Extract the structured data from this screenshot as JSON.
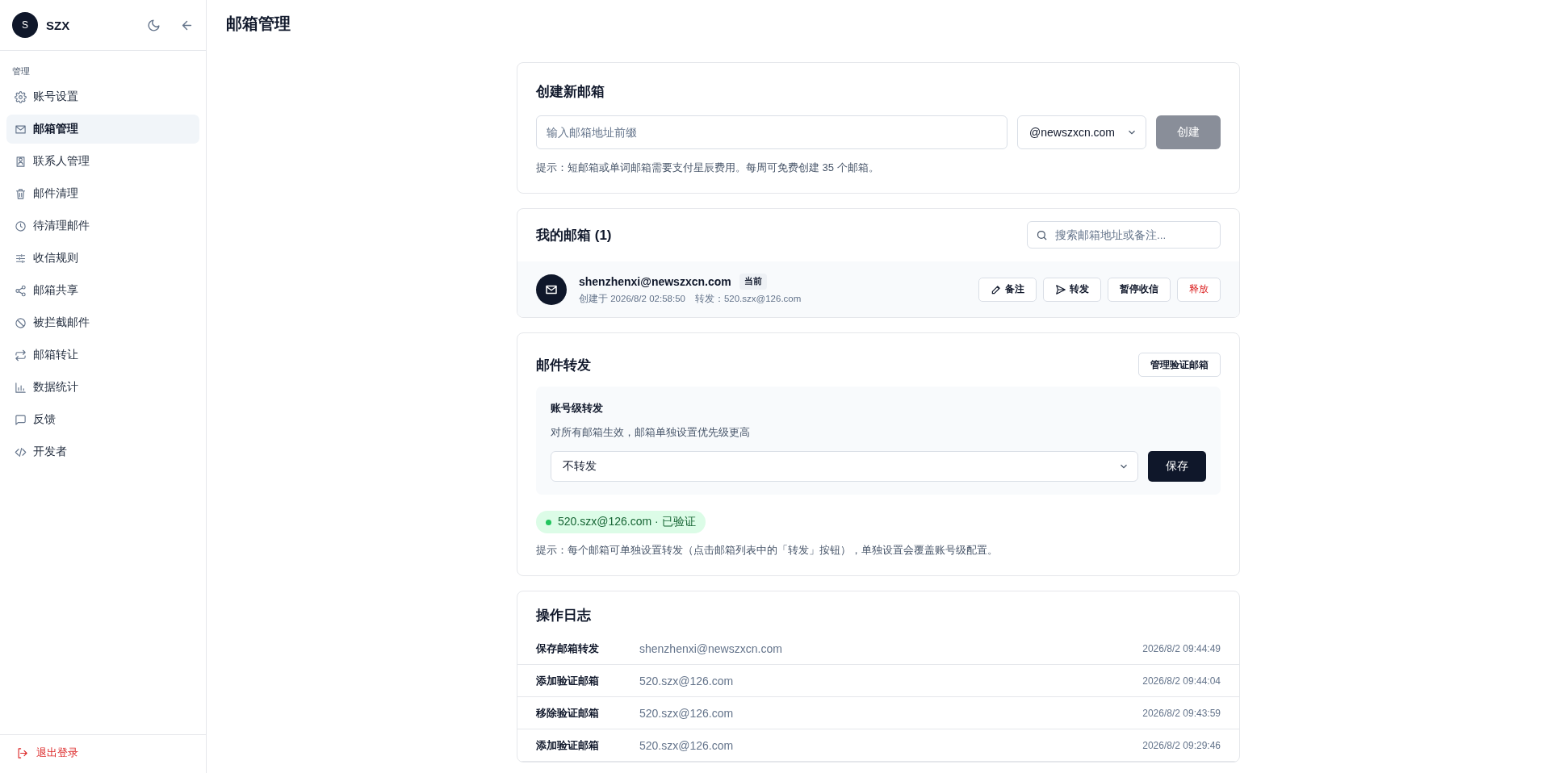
{
  "sidebar": {
    "user": {
      "initial": "S",
      "name": "SZX"
    },
    "section_label": "管理",
    "items": [
      {
        "label": "账号设置",
        "selected": false
      },
      {
        "label": "邮箱管理",
        "selected": true
      },
      {
        "label": "联系人管理",
        "selected": false
      },
      {
        "label": "邮件清理",
        "selected": false
      },
      {
        "label": "待清理邮件",
        "selected": false
      },
      {
        "label": "收信规则",
        "selected": false
      },
      {
        "label": "邮箱共享",
        "selected": false
      },
      {
        "label": "被拦截邮件",
        "selected": false
      },
      {
        "label": "邮箱转让",
        "selected": false
      },
      {
        "label": "数据统计",
        "selected": false
      },
      {
        "label": "反馈",
        "selected": false
      },
      {
        "label": "开发者",
        "selected": false
      }
    ],
    "logout": "退出登录"
  },
  "page_title": "邮箱管理",
  "create": {
    "title": "创建新邮箱",
    "placeholder": "输入邮箱地址前缀",
    "domain": "@newszxcn.com",
    "button": {
      "label": "创建",
      "disabled": true
    },
    "hint": "提示：短邮箱或单词邮箱需要支付星辰费用。每周可免费创建 35 个邮箱。"
  },
  "mailboxes": {
    "title": "我的邮箱 (1)",
    "search_placeholder": "搜索邮箱地址或备注...",
    "items": [
      {
        "address": "shenzhenxi@newszxcn.com",
        "badge": "当前",
        "created": "创建于 2026/8/2 02:58:50",
        "forward": "转发：520.szx@126.com",
        "actions": [
          {
            "label": "备注",
            "kind": "normal"
          },
          {
            "label": "转发",
            "kind": "normal"
          },
          {
            "label": "暂停收信",
            "kind": "normal"
          },
          {
            "label": "释放",
            "kind": "danger"
          }
        ]
      }
    ]
  },
  "forwarding": {
    "title": "邮件转发",
    "manage_button": "管理验证邮箱",
    "panel_title": "账号级转发",
    "panel_desc": "对所有邮箱生效，邮箱单独设置优先级更高",
    "select_value": "不转发",
    "save_button": "保存",
    "verified_emails": [
      {
        "label": "520.szx@126.com · 已验证",
        "color": "#22c55e"
      }
    ],
    "hint": "提示：每个邮箱可单独设置转发（点击邮箱列表中的「转发」按钮），单独设置会覆盖账号级配置。"
  },
  "log": {
    "title": "操作日志",
    "rows": [
      {
        "action": "保存邮箱转发",
        "target": "shenzhenxi@newszxcn.com",
        "time": "2026/8/2 09:44:49"
      },
      {
        "action": "添加验证邮箱",
        "target": "520.szx@126.com",
        "time": "2026/8/2 09:44:04"
      },
      {
        "action": "移除验证邮箱",
        "target": "520.szx@126.com",
        "time": "2026/8/2 09:43:59"
      },
      {
        "action": "添加验证邮箱",
        "target": "520.szx@126.com",
        "time": "2026/8/2 09:29:46"
      }
    ]
  }
}
